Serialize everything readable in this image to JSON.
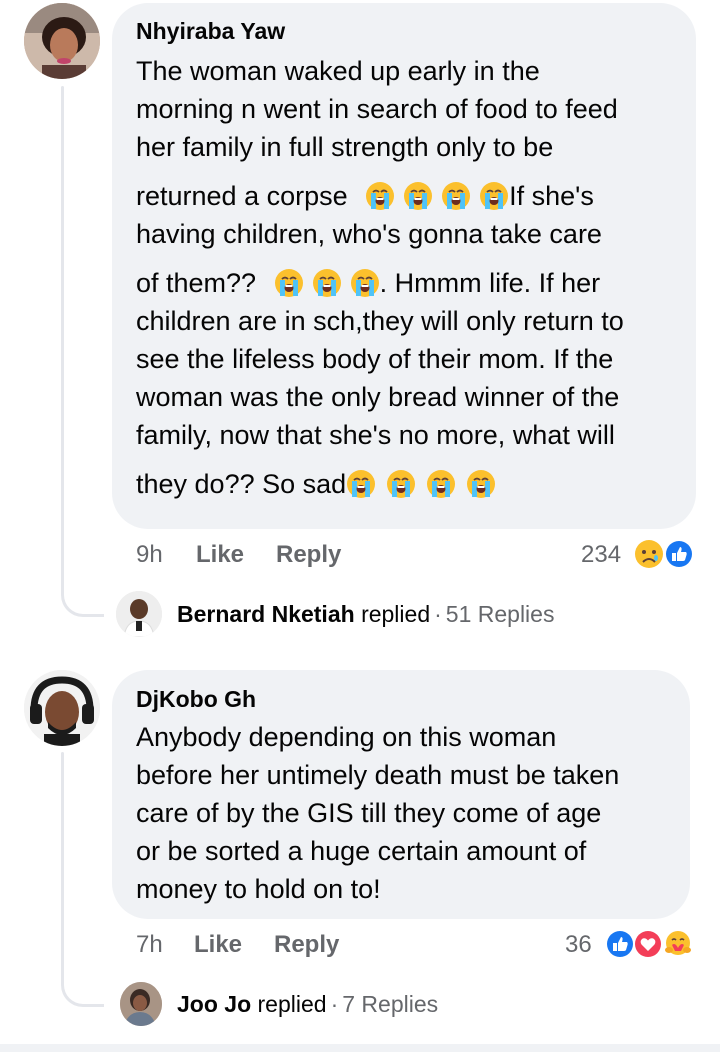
{
  "comments": [
    {
      "author": "Nhyiraba Yaw",
      "lines": [
        "The woman waked up early in the",
        "morning n went in search of food to feed",
        "her family in full strength only to be"
      ],
      "line4_text": "returned a corpse",
      "line4_after": "If she's",
      "line5": "having children, who's gonna take care",
      "line6_text": "of them??",
      "line6_after": ". Hmmm life. If her",
      "lines_b": [
        "children are in sch,they will only return to",
        "see the lifeless body of their mom. If the",
        "woman was the only bread winner of the",
        "family, now that she's no more, what will"
      ],
      "last_line_text": "they do?? So sad",
      "emoji": "loudly-crying-face",
      "time": "9h",
      "like_label": "Like",
      "reply_label": "Reply",
      "reaction_count": "234",
      "reactions": [
        "sad-face-icon",
        "like-icon"
      ],
      "reply_author": "Bernard Nketiah",
      "reply_verb": "replied",
      "reply_count": "51 Replies"
    },
    {
      "author": "DjKobo Gh",
      "lines": [
        "Anybody depending on this woman",
        "before her untimely death must be taken",
        "care of by the GIS till they come of age",
        "or be sorted a huge certain amount of",
        "money to hold on to!"
      ],
      "time": "7h",
      "like_label": "Like",
      "reply_label": "Reply",
      "reaction_count": "36",
      "reactions": [
        "like-icon",
        "love-icon",
        "care-icon"
      ],
      "reply_author": "Joo Jo",
      "reply_verb": "replied",
      "reply_count": "7 Replies"
    }
  ],
  "colors": {
    "bubble": "#f0f2f5",
    "secondary_text": "#65676b",
    "like_blue": "#1877f2",
    "love_red": "#f33e58",
    "emoji_yellow": "#fbc02d"
  }
}
